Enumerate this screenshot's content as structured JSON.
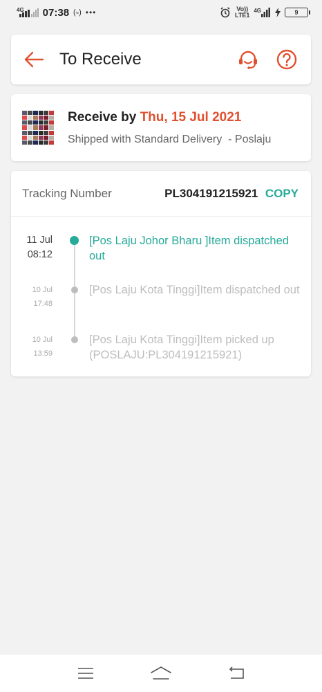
{
  "status_bar": {
    "network": "4G",
    "time": "07:38",
    "volte_top": "Vo))",
    "volte_bottom": "LTE1",
    "network2": "4G",
    "battery": "9"
  },
  "header": {
    "title": "To Receive",
    "icons": {
      "back": "arrow-left-icon",
      "support": "headset-icon",
      "help": "question-icon"
    },
    "accent": "#e0502f"
  },
  "delivery": {
    "receive_label": "Receive by",
    "receive_date": "Thu, 15 Jul 2021",
    "shipping_text": "Shipped with Standard Delivery  - Poslaju"
  },
  "tracking": {
    "label": "Tracking Number",
    "number": "PL304191215921",
    "copy_label": "COPY",
    "accent": "#26aa99",
    "events": [
      {
        "date": "11 Jul",
        "time": "08:12",
        "text": "[Pos Laju Johor Bharu ]Item dispatched out",
        "active": true
      },
      {
        "date": "10 Jul",
        "time": "17:48",
        "text": "[Pos Laju Kota Tinggi]Item dispatched out",
        "active": false
      },
      {
        "date": "10 Jul",
        "time": "13:59",
        "text": "[Pos Laju Kota Tinggi]Item picked up (POSLAJU:PL304191215921)",
        "active": false
      }
    ]
  },
  "nav_bar": {
    "icons": [
      "menu-icon",
      "home-icon",
      "back-icon"
    ]
  }
}
